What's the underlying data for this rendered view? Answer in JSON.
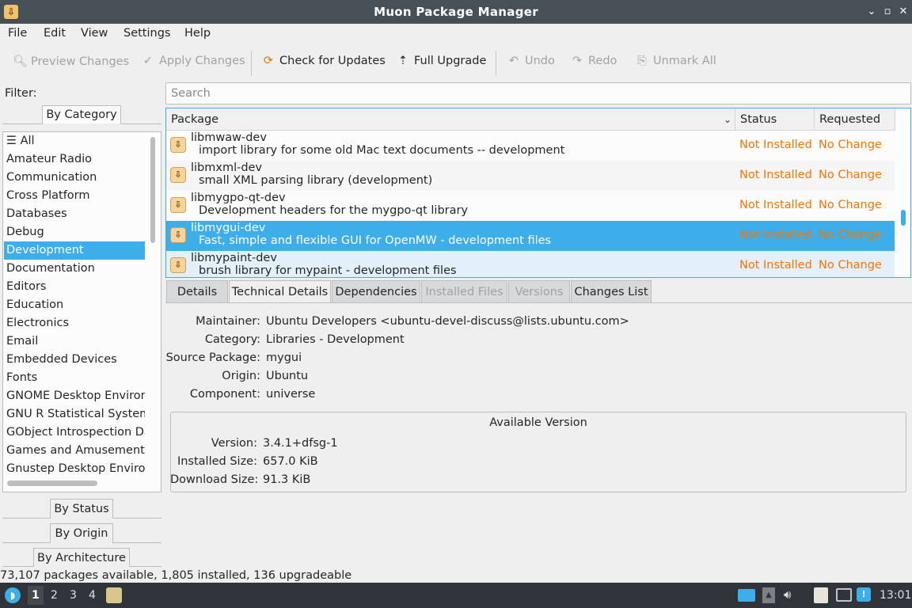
{
  "window": {
    "title": "Muon Package Manager",
    "app_icon": "download-package-icon"
  },
  "menu": [
    "File",
    "Edit",
    "View",
    "Settings",
    "Help"
  ],
  "toolbar": {
    "preview": "Preview Changes",
    "apply": "Apply Changes",
    "check": "Check for Updates",
    "upgrade": "Full Upgrade",
    "undo": "Undo",
    "redo": "Redo",
    "unmark": "Unmark All"
  },
  "filter": {
    "label": "Filter:",
    "by_category": "By Category",
    "by_status": "By Status",
    "by_origin": "By Origin",
    "by_architecture": "By Architecture",
    "all_label": "All",
    "categories": [
      "Amateur Radio",
      "Communication",
      "Cross Platform",
      "Databases",
      "Debug",
      "Development",
      "Documentation",
      "Editors",
      "Education",
      "Electronics",
      "Email",
      "Embedded Devices",
      "Fonts",
      "GNOME Desktop Environment",
      "GNU R Statistical System",
      "GObject Introspection Data",
      "Games and Amusement",
      "Gnustep Desktop Environment"
    ],
    "selected_category": "Development"
  },
  "search": {
    "placeholder": "Search"
  },
  "table": {
    "headers": {
      "package": "Package",
      "status": "Status",
      "requested": "Requested"
    },
    "rows": [
      {
        "name": "libmwaw-dev",
        "desc": "import library for some old Mac text documents -- development",
        "status": "Not Installed",
        "requested": "No Change"
      },
      {
        "name": "libmxml-dev",
        "desc": "small XML parsing library (development)",
        "status": "Not Installed",
        "requested": "No Change"
      },
      {
        "name": "libmygpo-qt-dev",
        "desc": "Development headers for the mygpo-qt library",
        "status": "Not Installed",
        "requested": "No Change"
      },
      {
        "name": "libmygui-dev",
        "desc": "Fast, simple and flexible GUI for OpenMW - development files",
        "status": "Not Installed",
        "requested": "No Change"
      },
      {
        "name": "libmypaint-dev",
        "desc": "brush library for mypaint - development files",
        "status": "Not Installed",
        "requested": "No Change"
      }
    ],
    "selected_package": "libmygui-dev"
  },
  "detail_tabs": [
    "Details",
    "Technical Details",
    "Dependencies",
    "Installed Files",
    "Versions",
    "Changes List"
  ],
  "technical": {
    "maintainer_label": "Maintainer:",
    "maintainer": "Ubuntu Developers <ubuntu-devel-discuss@lists.ubuntu.com>",
    "category_label": "Category:",
    "category": "Libraries - Development",
    "source_label": "Source Package:",
    "source": "mygui",
    "origin_label": "Origin:",
    "origin": "Ubuntu",
    "component_label": "Component:",
    "component": "universe"
  },
  "available_version": {
    "title": "Available Version",
    "version_label": "Version:",
    "version": "3.4.1+dfsg-1",
    "installed_size_label": "Installed Size:",
    "installed_size": "657.0 KiB",
    "download_size_label": "Download Size:",
    "download_size": "91.3 KiB"
  },
  "status": "73,107 packages available, 1,805 installed, 136 upgradeable",
  "taskbar": {
    "workspaces": [
      "1",
      "2",
      "3",
      "4"
    ],
    "clock": "13:01"
  },
  "colors": {
    "accent": "#3daee9",
    "status_orange": "#f67400",
    "titlebar": "#475057",
    "taskbar": "#2e3439"
  }
}
